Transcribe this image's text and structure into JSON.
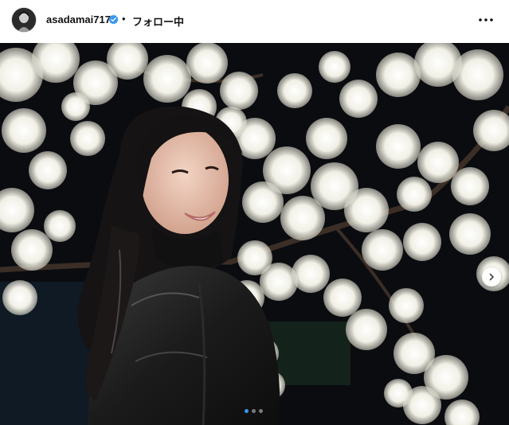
{
  "post": {
    "username": "asadamai717",
    "separator": "•",
    "follow_status": "フォロー中",
    "verified": true
  },
  "icons": {
    "avatar": "profile-avatar",
    "verified": "verified-badge-icon",
    "more": "more-options-icon",
    "next": "chevron-right-icon"
  },
  "carousel": {
    "count": 3,
    "active_index": 0
  },
  "colors": {
    "verified_blue": "#3897f0",
    "text": "#111111"
  }
}
